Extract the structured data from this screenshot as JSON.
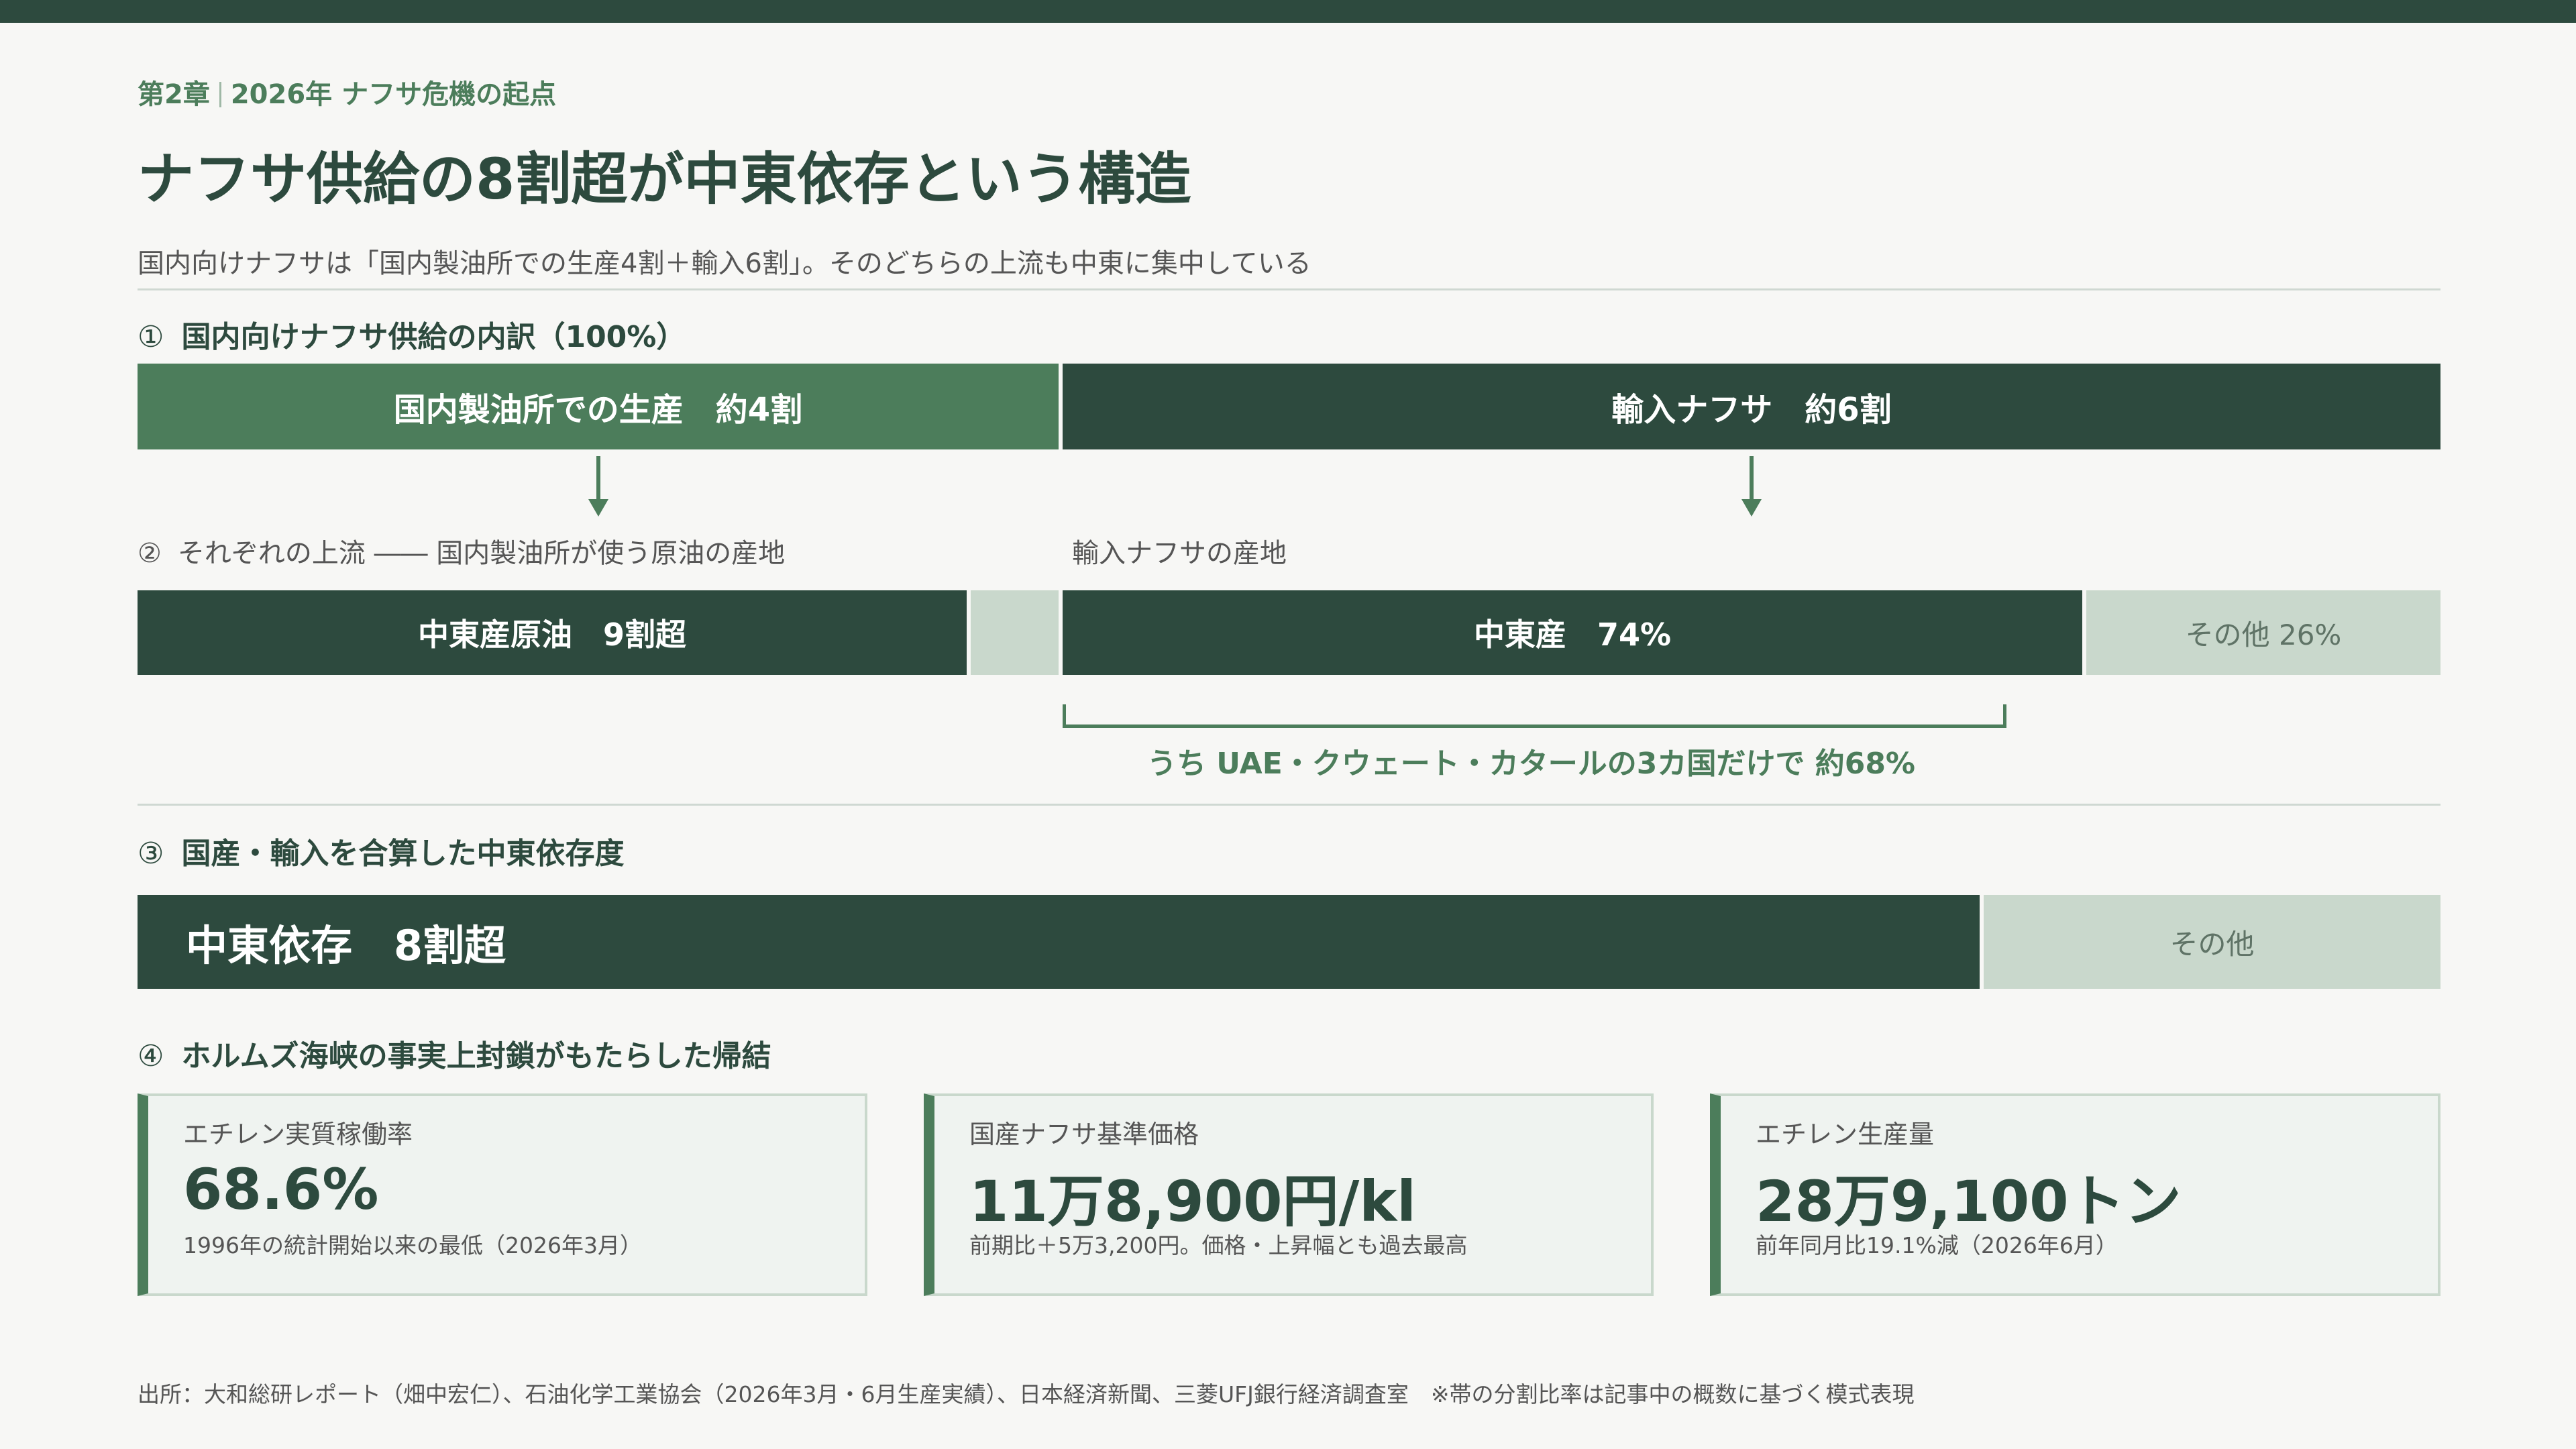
{
  "header": {
    "chapter": "第2章",
    "chapter_topic": "2026年 ナフサ危機の起点",
    "title": "ナフサ供給の8割超が中東依存という構造",
    "lead": "国内向けナフサは「国内製油所での生産4割＋輸入6割」。そのどちらの上流も中東に集中している"
  },
  "section1": {
    "num": "①",
    "title": "国内向けナフサ供給の内訳（100%）",
    "domestic": {
      "label": "国内製油所での生産　約4割",
      "share": 0.4
    },
    "imported": {
      "label": "輸入ナフサ　約6割",
      "share": 0.6
    }
  },
  "section2": {
    "num": "②",
    "domestic_label": "それぞれの上流 ―― 国内製油所が使う原油の産地",
    "imported_label": "輸入ナフサの産地",
    "domestic_mideast": {
      "label": "中東産原油　9割超",
      "share": 0.9
    },
    "imported_mideast": {
      "label": "中東産　74%",
      "share": 0.74
    },
    "imported_other": {
      "label": "その他 26%",
      "share": 0.26
    },
    "note": "うち UAE・クウェート・カタールの3カ国だけで 約68%",
    "note_share": 0.68
  },
  "section3": {
    "num": "③",
    "title": "国産・輸入を合算した中東依存度",
    "mideast": {
      "label": "中東依存　8割超",
      "share": 0.8
    },
    "other": {
      "label": "その他"
    }
  },
  "section4": {
    "num": "④",
    "title": "ホルムズ海峡の事実上封鎖がもたらした帰結",
    "cards": [
      {
        "label": "エチレン実質稼働率",
        "value": "68.6%",
        "desc": "1996年の統計開始以来の最低（2026年3月）"
      },
      {
        "label": "国産ナフサ基準価格",
        "value": "11万8,900円/kl",
        "desc": "前期比＋5万3,200円。価格・上昇幅とも過去最高"
      },
      {
        "label": "エチレン生産量",
        "value": "28万9,100トン",
        "desc": "前年同月比19.1%減（2026年6月）"
      }
    ]
  },
  "source": "出所：大和総研レポート（畑中宏仁）、石油化学工業協会（2026年3月・6月生産実績）、日本経済新聞、三菱UFJ銀行経済調査室　※帯の分割比率は記事中の概数に基づく模式表現",
  "colors": {
    "dark": "#2d4a3e",
    "mid": "#4c7d5b",
    "pale": "#c9d8cc",
    "background": "#f7f7f5"
  }
}
